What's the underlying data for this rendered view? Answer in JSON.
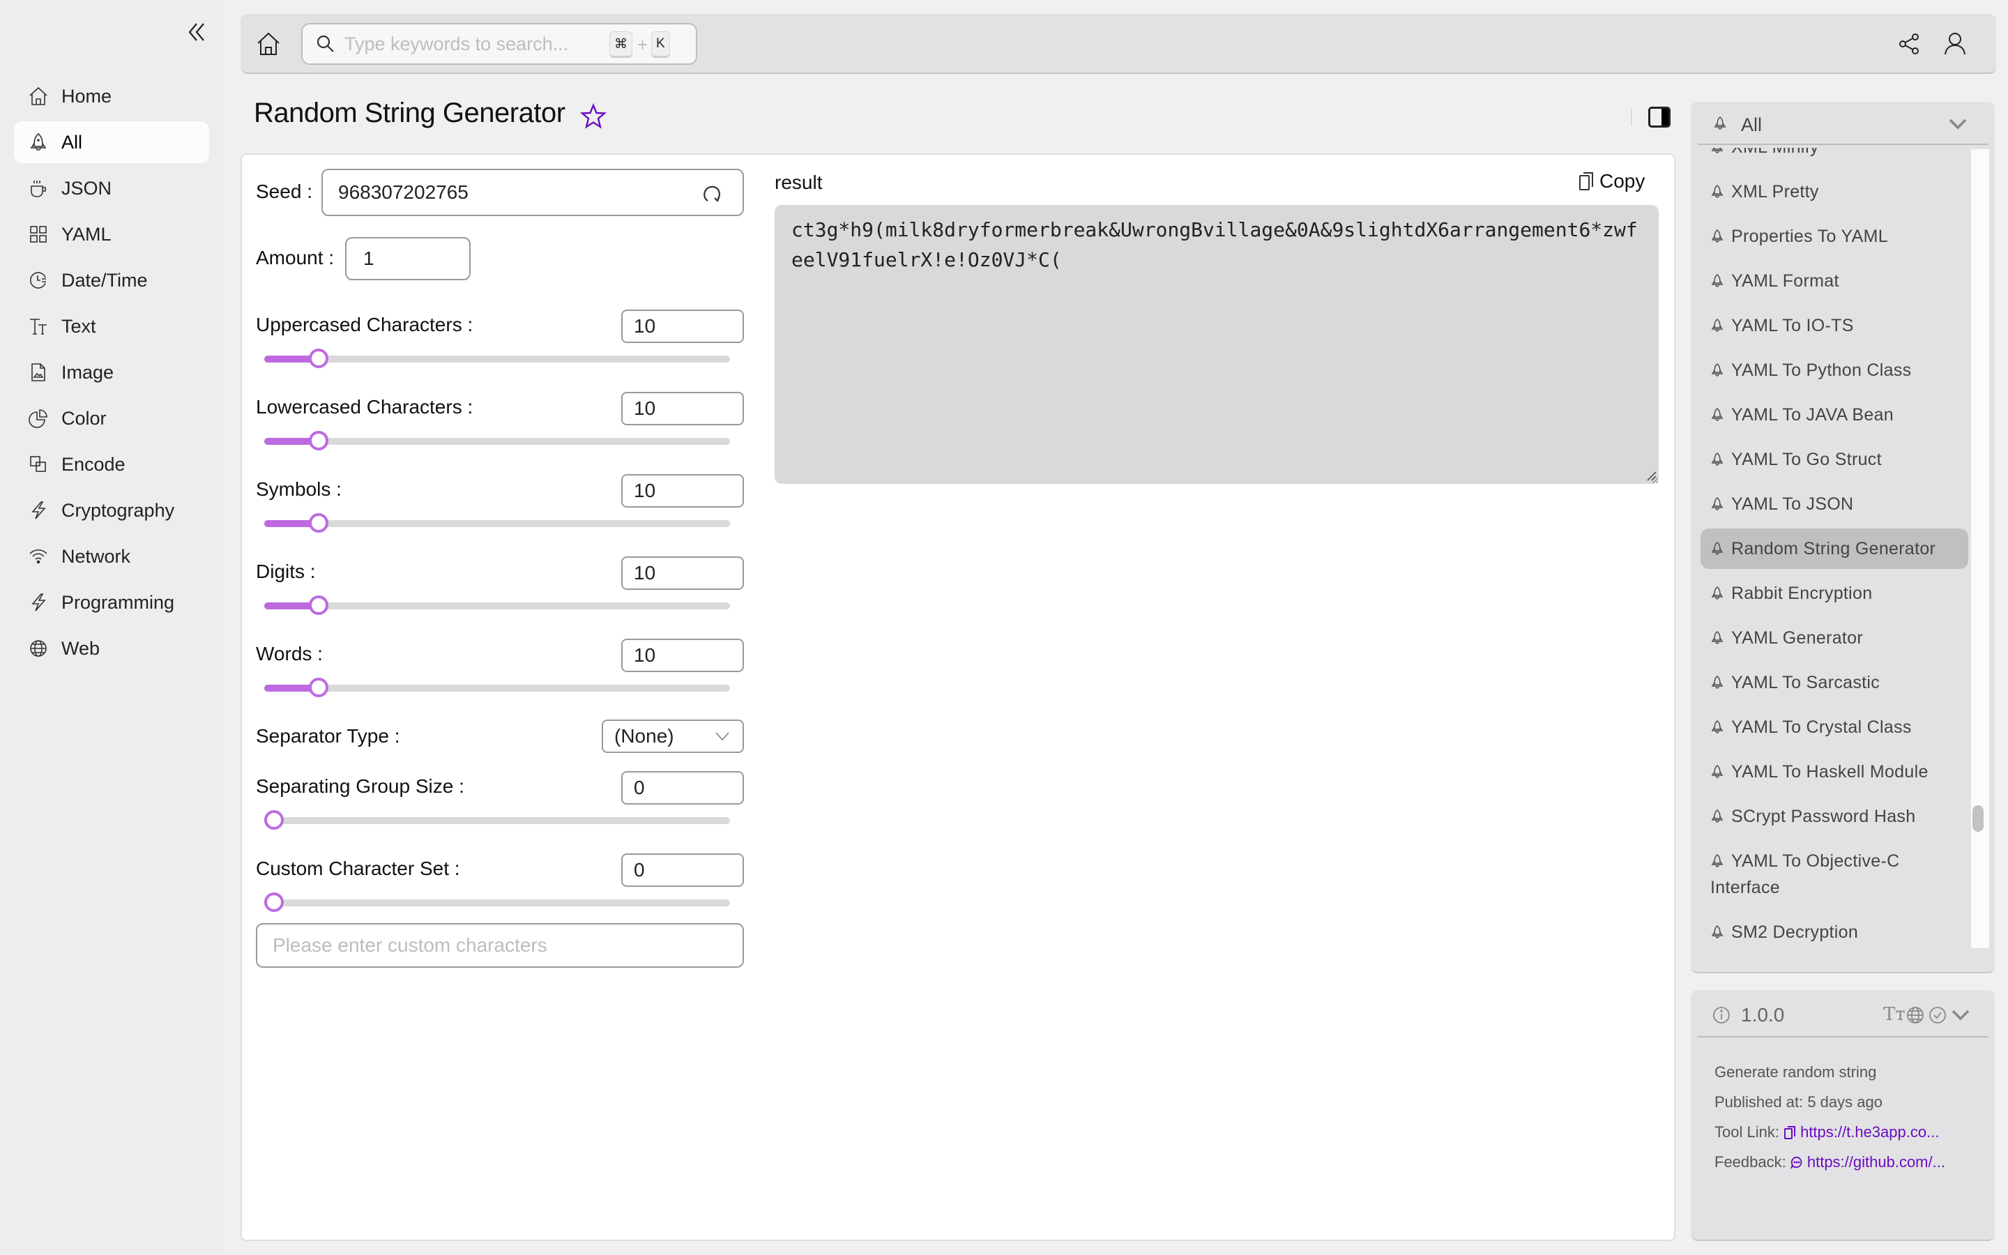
{
  "sidebar": {
    "collapse_icon": "double-chevron-left",
    "items": [
      {
        "label": "Home",
        "icon": "home-icon",
        "active": false
      },
      {
        "label": "All",
        "icon": "rocket-icon",
        "active": true
      },
      {
        "label": "JSON",
        "icon": "cup-icon",
        "active": false
      },
      {
        "label": "YAML",
        "icon": "grid-icon",
        "active": false
      },
      {
        "label": "Date/Time",
        "icon": "clock-icon",
        "active": false
      },
      {
        "label": "Text",
        "icon": "text-size-icon",
        "active": false
      },
      {
        "label": "Image",
        "icon": "image-file-icon",
        "active": false
      },
      {
        "label": "Color",
        "icon": "pie-icon",
        "active": false
      },
      {
        "label": "Encode",
        "icon": "overlap-squares-icon",
        "active": false
      },
      {
        "label": "Cryptography",
        "icon": "lightning-icon",
        "active": false
      },
      {
        "label": "Network",
        "icon": "wifi-icon",
        "active": false
      },
      {
        "label": "Programming",
        "icon": "lightning-icon",
        "active": false
      },
      {
        "label": "Web",
        "icon": "globe-icon",
        "active": false
      }
    ]
  },
  "topbar": {
    "search_placeholder": "Type keywords to search...",
    "search_value": "",
    "shortcut_mod": "⌘",
    "shortcut_plus": "+",
    "shortcut_key": "K"
  },
  "page": {
    "title": "Random String Generator",
    "favorited": false
  },
  "form": {
    "seed_label": "Seed",
    "seed_value": "968307202765",
    "amount_label": "Amount",
    "amount_value": "1",
    "sliders": [
      {
        "label": "Uppercased Characters",
        "value": "10",
        "fraction": 0.1
      },
      {
        "label": "Lowercased Characters",
        "value": "10",
        "fraction": 0.1
      },
      {
        "label": "Symbols",
        "value": "10",
        "fraction": 0.1
      },
      {
        "label": "Digits",
        "value": "10",
        "fraction": 0.1
      },
      {
        "label": "Words",
        "value": "10",
        "fraction": 0.1
      }
    ],
    "separator_label": "Separator Type",
    "separator_value": "(None)",
    "group_size": {
      "label": "Separating Group Size",
      "value": "0",
      "fraction": 0
    },
    "custom_set": {
      "label": "Custom Character Set",
      "value": "0",
      "fraction": 0
    },
    "custom_placeholder": "Please enter custom characters",
    "custom_value": "",
    "colon": ":"
  },
  "result": {
    "label": "result",
    "copy_label": "Copy",
    "value": "ct3g*h9(milk8dryformerbreak&UwrongBvillage&0A&9slightdX6arrangement6*zwfeelV91fuelrX!e!Oz0VJ*C("
  },
  "tools_panel": {
    "category": "All",
    "items": [
      {
        "label": "XML Minify",
        "active": false
      },
      {
        "label": "XML Pretty",
        "active": false
      },
      {
        "label": "Properties To YAML",
        "active": false
      },
      {
        "label": "YAML Format",
        "active": false
      },
      {
        "label": "YAML To IO-TS",
        "active": false
      },
      {
        "label": "YAML To Python Class",
        "active": false
      },
      {
        "label": "YAML To JAVA Bean",
        "active": false
      },
      {
        "label": "YAML To Go Struct",
        "active": false
      },
      {
        "label": "YAML To JSON",
        "active": false
      },
      {
        "label": "Random String Generator",
        "active": true
      },
      {
        "label": "Rabbit Encryption",
        "active": false
      },
      {
        "label": "YAML Generator",
        "active": false
      },
      {
        "label": "YAML To Sarcastic",
        "active": false
      },
      {
        "label": "YAML To Crystal Class",
        "active": false
      },
      {
        "label": "YAML To Haskell Module",
        "active": false
      },
      {
        "label": "SCrypt Password Hash",
        "active": false
      },
      {
        "label": "YAML To Objective-C Interface",
        "active": false
      },
      {
        "label": "SM2 Decryption",
        "active": false
      }
    ]
  },
  "info_panel": {
    "version": "1.0.0",
    "text_icon_glyph": "Tт",
    "description": "Generate random string",
    "published_label": "Published at:",
    "published_value": "5 days ago",
    "tool_link_label": "Tool Link:",
    "tool_link_value": "https://t.he3app.co...",
    "feedback_label": "Feedback:",
    "feedback_value": "https://github.com/..."
  },
  "colors": {
    "accent": "#6a0dbf",
    "slider": "#bd6ae0",
    "sidebar_bg": "#ededed",
    "panel_bg": "#e2e2e4",
    "result_bg": "#d9d9d9"
  }
}
